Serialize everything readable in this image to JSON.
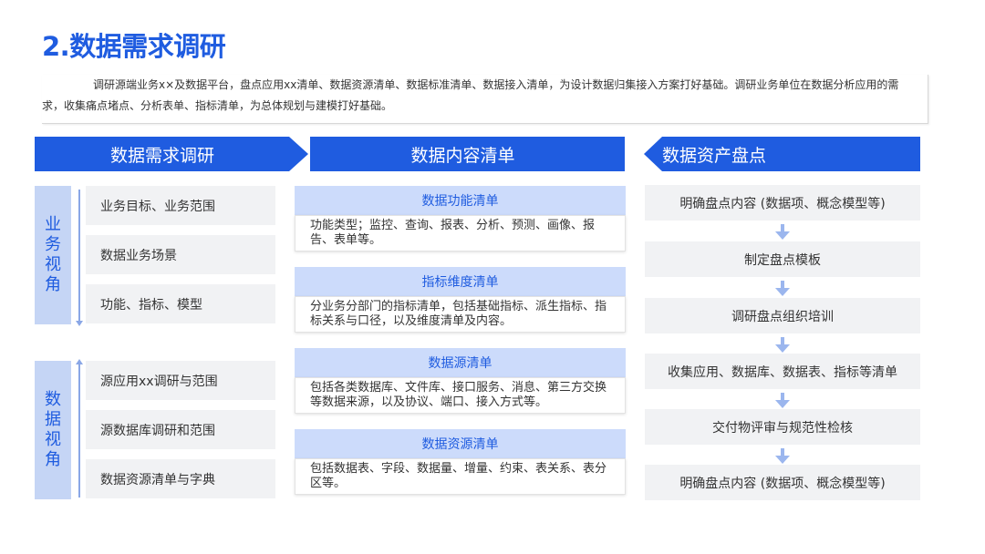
{
  "title": "2.数据需求调研",
  "intro": "调研源端业务x×及数据平台，盘点应用xx清单、数据资源清单、数据标准清单、数据接入清单，为设计数据归集接入方案打好基础。调研业务单位在数据分析应用的需求，收集痛点堵点、分析表单、指标清单，为总体规划与建模打好基础。",
  "columns": {
    "research": "数据需求调研",
    "content": "数据内容清单",
    "assets": "数据资产盘点"
  },
  "business_view": {
    "label": [
      "业",
      "务",
      "视",
      "角"
    ],
    "items": [
      "业务目标、业务范围",
      "数据业务场景",
      "功能、指标、模型"
    ]
  },
  "data_view": {
    "label": [
      "数",
      "据",
      "视",
      "角"
    ],
    "items": [
      "源应用xx调研与范围",
      "源数据库调研和范围",
      "数据资源清单与字典"
    ]
  },
  "cards": [
    {
      "title": "数据功能清单",
      "body": "功能类型；监控、查询、报表、分析、预测、画像、报告、表单等。"
    },
    {
      "title": "指标维度清单",
      "body": "分业务分部门的指标清单，包括基础指标、派生指标、指标关系与口径，以及维度清单及内容。"
    },
    {
      "title": "数据源清单",
      "body": "包括各类数据库、文件库、接口服务、消息、第三方交换等数据来源，以及协议、端口、接入方式等。"
    },
    {
      "title": "数据资源清单",
      "body": "包括数据表、字段、数据量、增量、约束、表关系、表分区等。"
    }
  ],
  "asset_steps": [
    "明确盘点内容 (数据项、概念模型等)",
    "制定盘点模板",
    "调研盘点组织培训",
    "收集应用、数据库、数据表、指标等清单",
    "交付物评审与规范性检核",
    "明确盘点内容 (数据项、概念模型等)"
  ],
  "colors": {
    "accent": "#1f5ce0",
    "light_accent": "#ccdbfb",
    "side_fill": "#c5d5f5",
    "item_fill": "#f1f2f4"
  }
}
